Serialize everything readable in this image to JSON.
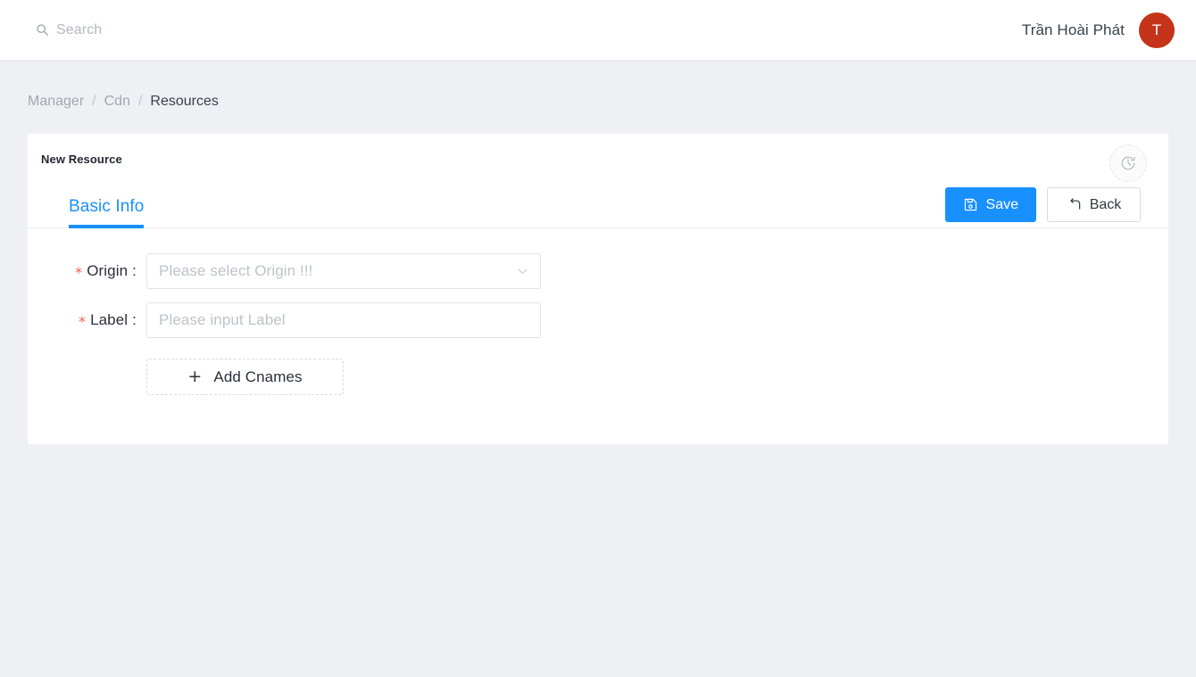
{
  "header": {
    "search": {
      "icon": "search-icon",
      "placeholder": "Search"
    },
    "user": {
      "name": "Trần Hoài Phát",
      "avatar_initial": "T",
      "avatar_color": "#c4331a"
    }
  },
  "breadcrumb": {
    "items": [
      {
        "label": "Manager",
        "current": false
      },
      {
        "label": "Cdn",
        "current": false
      },
      {
        "label": "Resources",
        "current": true
      }
    ],
    "separator": "/"
  },
  "card": {
    "title": "New Resource",
    "history_button": {
      "icon": "clock-history-icon",
      "tooltip": ""
    },
    "tabs": [
      {
        "label": "Basic Info",
        "active": true
      }
    ],
    "actions": {
      "save": {
        "label": "Save",
        "icon": "save-icon"
      },
      "back": {
        "label": "Back",
        "icon": "rollback-icon"
      }
    },
    "form": {
      "fields": [
        {
          "label": "Origin",
          "colon": ":",
          "required": true,
          "type": "select",
          "value": "",
          "placeholder": "Please select Origin !!!",
          "icon": "chevron-down-icon"
        },
        {
          "label": "Label",
          "colon": ":",
          "required": true,
          "type": "text",
          "value": "",
          "placeholder": "Please input Label"
        }
      ],
      "add_button": {
        "label": "Add Cnames",
        "icon": "plus-icon",
        "glyph": "+"
      },
      "required_marker": "*"
    }
  },
  "theme": {
    "accent": "#1890ff",
    "page_background": "#eff0f4",
    "required_color": "#f4604e"
  }
}
